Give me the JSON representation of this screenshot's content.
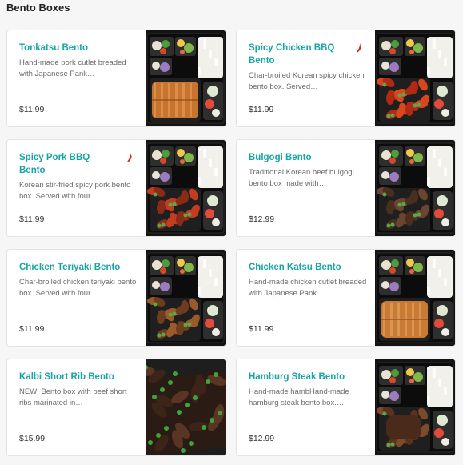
{
  "section": {
    "title": "Bento Boxes"
  },
  "colors": {
    "accent": "#1aa5a5",
    "spicy": "#d8251c"
  },
  "items": [
    {
      "name": "Tonkatsu Bento",
      "desc": "Hand-made pork cutlet breaded with Japanese Pank…",
      "price": "$11.99",
      "spicy": false,
      "photo": "tonkatsu"
    },
    {
      "name": "Spicy Chicken BBQ Bento",
      "desc": "Char-broiled Korean spicy chicken bento box. Served…",
      "price": "$11.99",
      "spicy": true,
      "photo": "spicy-chicken"
    },
    {
      "name": "Spicy Pork BBQ Bento",
      "desc": "Korean stir-fried spicy pork bento box. Served with four…",
      "price": "$11.99",
      "spicy": true,
      "photo": "spicy-pork"
    },
    {
      "name": "Bulgogi Bento",
      "desc": "Traditional Korean beef bulgogi bento box made with…",
      "price": "$12.99",
      "spicy": false,
      "photo": "bulgogi"
    },
    {
      "name": "Chicken Teriyaki Bento",
      "desc": "Char-broiled chicken teriyaki bento box. Served with four…",
      "price": "$11.99",
      "spicy": false,
      "photo": "teriyaki"
    },
    {
      "name": "Chicken Katsu Bento",
      "desc": "Hand-made chicken cutlet breaded with Japanese Pank…",
      "price": "$11.99",
      "spicy": false,
      "photo": "katsu"
    },
    {
      "name": "Kalbi Short Rib Bento",
      "desc": "NEW! Bento box with beef short ribs marinated in…",
      "price": "$15.99",
      "spicy": false,
      "photo": "kalbi"
    },
    {
      "name": "Hamburg Steak Bento",
      "desc": "Hand-made hambHand-made hamburg steak bento box.…",
      "price": "$12.99",
      "spicy": false,
      "photo": "hamburg"
    }
  ]
}
